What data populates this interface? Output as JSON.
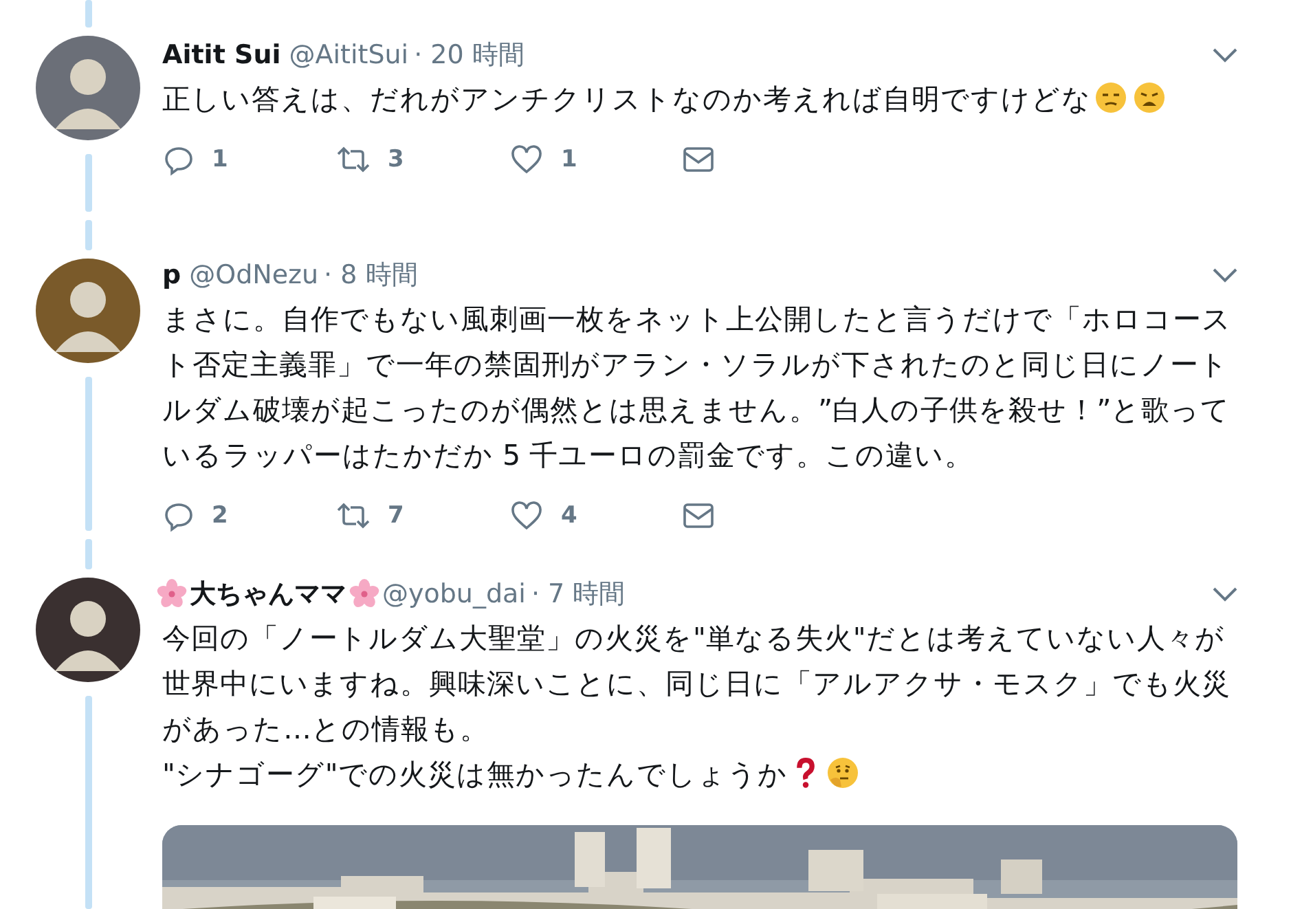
{
  "tweets": [
    {
      "kind": "faces",
      "name": "Aitit Sui",
      "handle": "@AititSui",
      "time": "· 20 時間",
      "body": "正しい答えは、だれがアンチクリストなのか考えれば自明ですけどな",
      "replies": "1",
      "retweets": "3",
      "likes": "1"
    },
    {
      "kind": "plain",
      "name": "p",
      "handle": "@OdNezu",
      "time": "· 8 時間",
      "body": "まさに。自作でもない風刺画一枚をネット上公開したと言うだけで「ホロコースト否定主義罪」で一年の禁固刑がアラン・ソラルが下されたのと同じ日にノートルダム破壊が起こったのが偶然とは思えません。”白人の子供を殺せ！”と歌っているラッパーはたかだか 5 千ユーロの罰金です。この違い。",
      "replies": "2",
      "retweets": "7",
      "likes": "4"
    },
    {
      "kind": "flowers",
      "name": "大ちゃんママ",
      "handle": "@yobu_dai",
      "time": "· 7 時間",
      "body": "今回の「ノートルダム大聖堂」の火災を\"単なる失火\"だとは考えていない人々が世界中にいますね。興味深いことに、同じ日に「アルアクサ・モスク」でも火災があった…との情報も。\n\"シナゴーグ\"での火災は無かったんでしょうか"
    }
  ]
}
